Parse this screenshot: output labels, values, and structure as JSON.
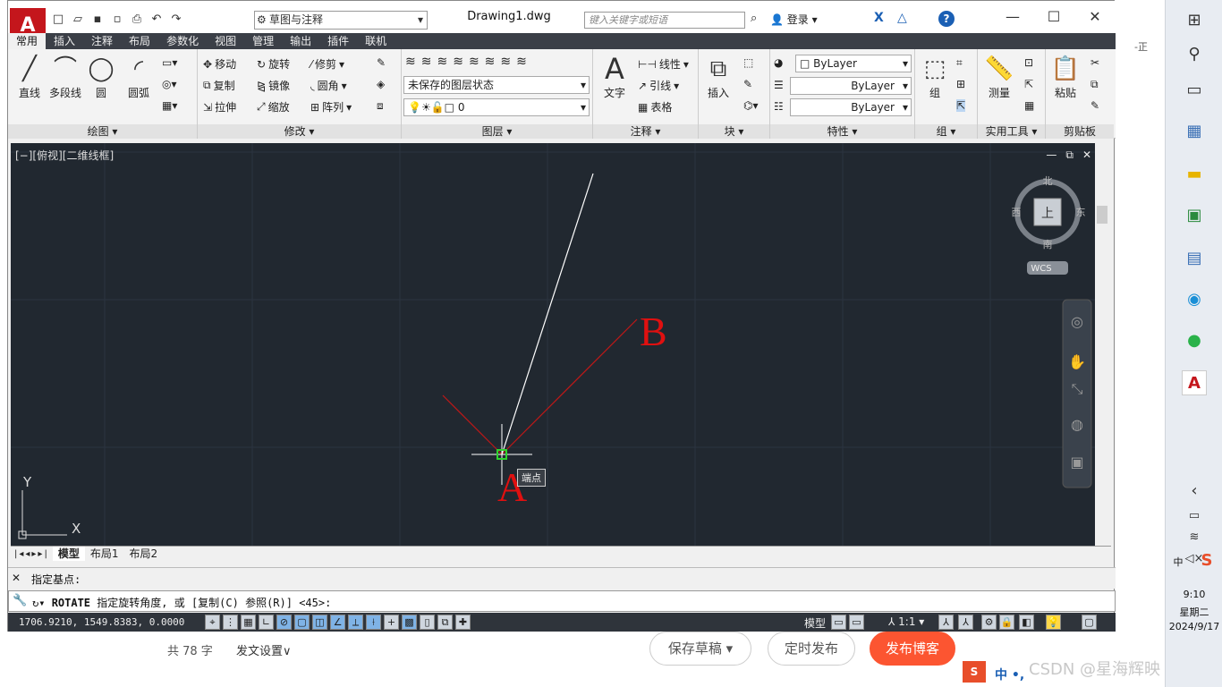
{
  "app": {
    "logo": "A",
    "workspace": "草图与注释",
    "doc_title": "Drawing1.dwg",
    "search_placeholder": "键入关键字或短语",
    "login": "登录",
    "help": "?"
  },
  "tabs": [
    "常用",
    "插入",
    "注释",
    "布局",
    "参数化",
    "视图",
    "管理",
    "输出",
    "插件",
    "联机"
  ],
  "ribbon": {
    "draw": {
      "title": "绘图",
      "line": "直线",
      "polyline": "多段线",
      "circle": "圆",
      "arc": "圆弧"
    },
    "modify": {
      "title": "修改",
      "move": "移动",
      "rotate": "旋转",
      "trim": "修剪",
      "copy": "复制",
      "mirror": "镜像",
      "fillet": "圆角",
      "stretch": "拉伸",
      "scale": "缩放",
      "array": "阵列"
    },
    "layers": {
      "title": "图层",
      "state": "未保存的图层状态",
      "current": "0"
    },
    "annotation": {
      "title": "注释",
      "text": "文字",
      "linear": "线性",
      "leader": "引线",
      "table": "表格"
    },
    "block": {
      "title": "块",
      "insert": "插入"
    },
    "properties": {
      "title": "特性",
      "color": "ByLayer",
      "linetype": "ByLayer",
      "lineweight": "ByLayer"
    },
    "groups": {
      "title": "组",
      "group": "组"
    },
    "utilities": {
      "title": "实用工具",
      "measure": "测量"
    },
    "clipboard": {
      "title": "剪贴板",
      "paste": "粘贴"
    }
  },
  "viewport": {
    "label": "[−][俯视][二维线框]",
    "compass": {
      "n": "北",
      "s": "南",
      "e": "东",
      "w": "西",
      "top": "上",
      "wcs": "WCS"
    },
    "point_a": "A",
    "point_b": "B",
    "tooltip": "端点",
    "ucs_x": "X",
    "ucs_y": "Y"
  },
  "layout_tabs": [
    "模型",
    "布局1",
    "布局2"
  ],
  "command": {
    "history": "指定基点:",
    "prompt_cmd": "ROTATE",
    "prompt_text": "指定旋转角度, 或 [复制(C) 参照(R)] <45>:"
  },
  "status": {
    "coords": "1706.9210, 1549.8383, 0.0000",
    "model": "模型",
    "scale": "1:1"
  },
  "footer": {
    "word_count": "共 78 字",
    "settings": "发文设置",
    "save_draft": "保存草稿",
    "schedule": "定时发布",
    "publish": "发布博客",
    "watermark": "CSDN @星海辉映"
  },
  "taskbar": {
    "time": "9:10",
    "weekday": "星期二",
    "date": "2024/9/17",
    "ime": "中"
  },
  "colors": {
    "accent_red": "#c4161c",
    "viewport_bg": "#212830",
    "publish": "#fc5531"
  }
}
